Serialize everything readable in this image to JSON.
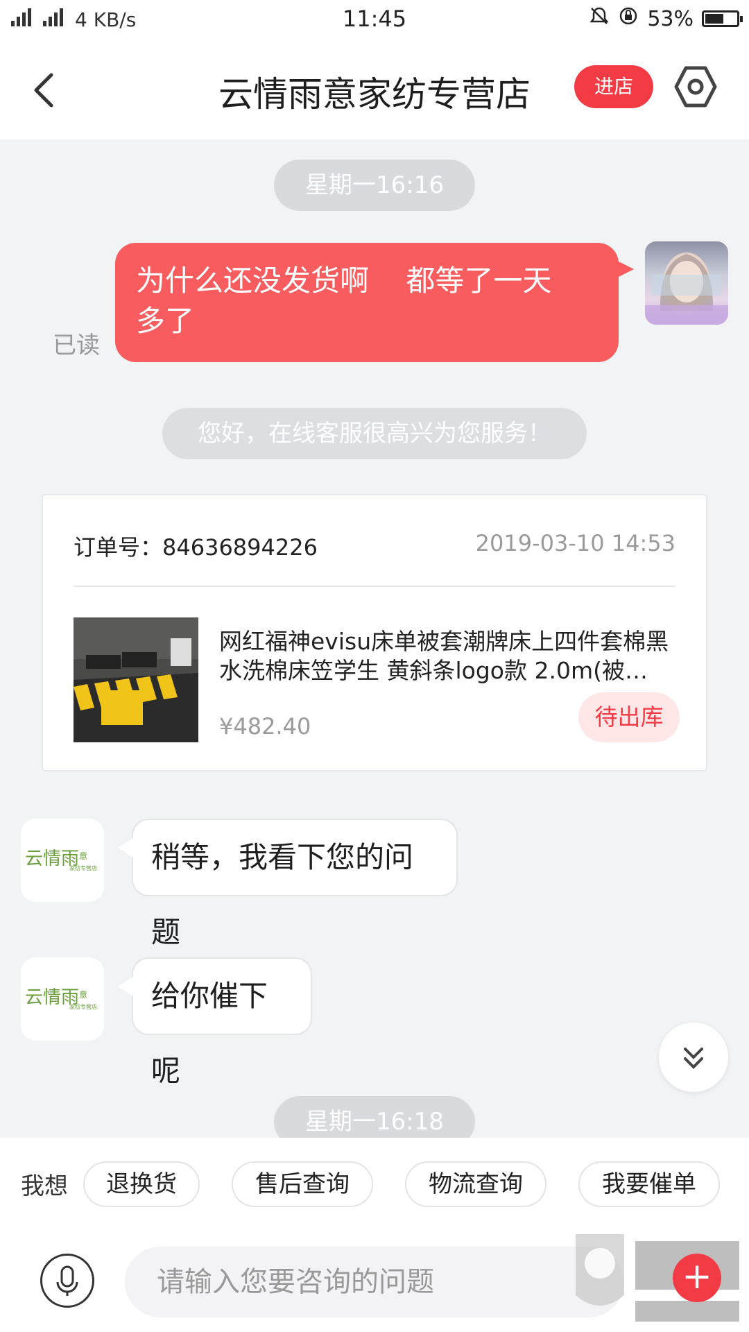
{
  "status_bar": {
    "network": "3G 4G",
    "speed": "4 KB/s",
    "time": "11:45",
    "battery": "53%"
  },
  "header": {
    "title": "云情雨意家纺专营店",
    "enter_store_label": "进店"
  },
  "chat": {
    "time_divider_1": "星期一16:16",
    "my_message": "为什么还没发货啊    都等了一天\n多了",
    "read_label": "已读",
    "system_message": "您好，在线客服很高兴为您服务！",
    "order": {
      "order_no": "订单号：84636894226",
      "order_time": "2019-03-10  14:53",
      "product_title_line1": "网红福神evisu床单被套潮牌床上四件套棉黑",
      "product_title_line2": "水洗棉床笠学生 黄斜条logo款 2.0m(被…",
      "price": "¥482.40",
      "status": "待出库"
    },
    "agent_message_1": "稍等，我看下您的问题",
    "agent_message_2": "给你催下呢",
    "time_divider_2": "星期一16:18"
  },
  "quick_actions": {
    "label": "我想",
    "chips": [
      "退换货",
      "售后查询",
      "物流查询",
      "我要催单"
    ]
  },
  "input": {
    "placeholder": "请输入您要咨询的问题"
  },
  "colors": {
    "accent": "#f23b45",
    "my_bubble": "#f85c5e",
    "background": "#f2f3f5"
  }
}
